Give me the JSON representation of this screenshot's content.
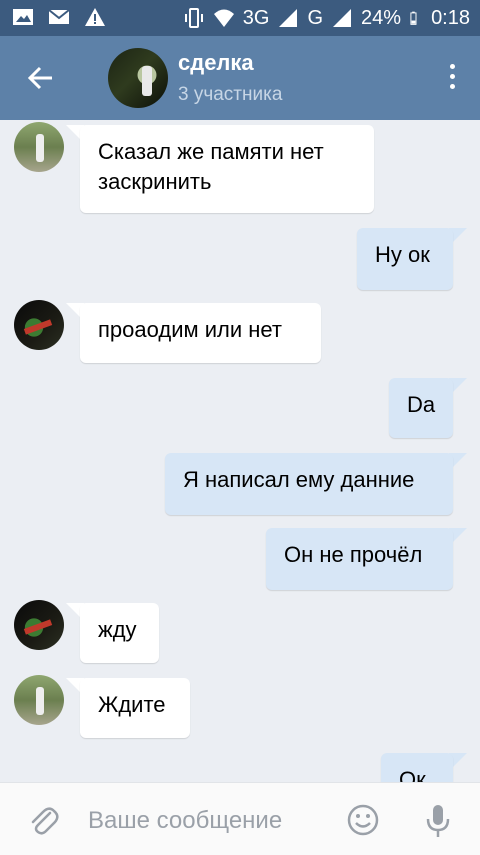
{
  "status_bar": {
    "icons_left": [
      "image-icon",
      "mail-icon",
      "warning-icon"
    ],
    "network": "3G",
    "network2": "G",
    "battery": "24%",
    "time": "0:18"
  },
  "header": {
    "title": "сделка",
    "subtitle": "3 участника",
    "back_icon": "arrow-left-icon",
    "menu_icon": "more-vert-icon"
  },
  "messages": [
    {
      "dir": "in",
      "avatar": "a1",
      "lines": [
        "Сказал же памяти нет",
        "заскринить"
      ]
    },
    {
      "dir": "out",
      "lines": [
        "Ну ок"
      ]
    },
    {
      "dir": "in",
      "avatar": "a2",
      "lines": [
        "проаодим или нет"
      ]
    },
    {
      "dir": "out",
      "lines": [
        "Da"
      ]
    },
    {
      "dir": "out",
      "lines": [
        "Я написал ему данние"
      ]
    },
    {
      "dir": "out",
      "lines": [
        "Он не прочёл"
      ]
    },
    {
      "dir": "in",
      "avatar": "a2",
      "lines": [
        "жду"
      ]
    },
    {
      "dir": "in",
      "avatar": "a1",
      "lines": [
        "Ждите"
      ]
    },
    {
      "dir": "out",
      "lines": [
        "Ок"
      ]
    }
  ],
  "composer": {
    "placeholder": "Ваше сообщение",
    "attach_icon": "paperclip-icon",
    "emoji_icon": "smile-icon",
    "mic_icon": "microphone-icon"
  },
  "colors": {
    "header": "#5d81a8",
    "status_bar": "#3c5b7f",
    "background": "#ebeef3",
    "incoming": "#ffffff",
    "outgoing": "#d7e6f6"
  }
}
